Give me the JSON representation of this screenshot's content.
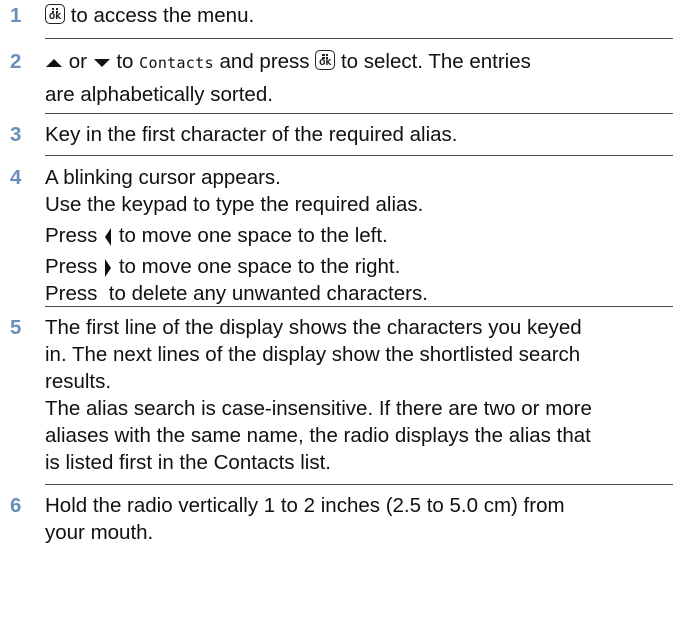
{
  "icons": {
    "ok_key": "menu-ok-key-icon",
    "ok_key_text": "OK",
    "up": "up-arrow-icon",
    "down": "down-arrow-icon",
    "left": "left-arrow-icon",
    "right": "right-arrow-icon"
  },
  "colors": {
    "step_number": "#6a8fb8",
    "divider": "#4b4b4b",
    "text": "#111111"
  },
  "steps": [
    {
      "number": "1",
      "line1_text": "to access the menu."
    },
    {
      "number": "2",
      "or": "or",
      "to": "to",
      "menu_item": "Contacts",
      "after_item": "and press",
      "tail": "to select. The entries",
      "line2": "are alphabetically sorted."
    },
    {
      "number": "3",
      "line1": "Key in the first character of the required alias."
    },
    {
      "number": "4",
      "line1": "A blinking cursor appears.",
      "line2": "Use the keypad to type the required alias.",
      "press_left_pre": "Press",
      "press_left_post": "to move one space to the left.",
      "press_right_pre": "Press",
      "press_right_post": "to move one space to the right.",
      "line5": "Press  to delete any unwanted characters."
    },
    {
      "number": "5",
      "line1": "The first line of the display shows the characters you keyed",
      "line2": "in. The next lines of the display show the shortlisted search",
      "line3": "results.",
      "line4": "The alias search is case-insensitive. If there are two or more",
      "line5": "aliases with the same name, the radio displays the alias that",
      "line6": "is listed first in the Contacts list."
    },
    {
      "number": "6",
      "line1": "Hold the radio vertically 1 to 2 inches (2.5 to 5.0 cm) from",
      "line2": "your mouth."
    }
  ]
}
